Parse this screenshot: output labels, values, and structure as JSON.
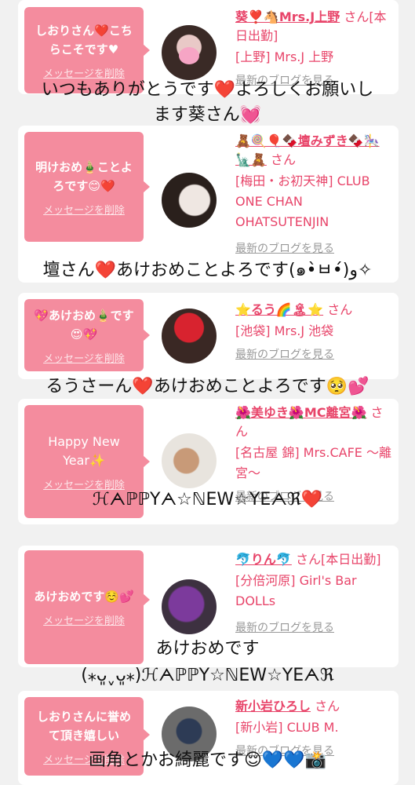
{
  "cards": [
    {
      "bubble": "しおりさん❤️こちらこそです♥",
      "delete": "メッセージを削除",
      "name": "葵❣️🐴Mrs.J上野",
      "san": "さん[本日出勤]",
      "shop": "[上野] Mrs.J 上野",
      "blog": "最新のブログを見る"
    },
    {
      "bubble": "明けおめ🎍ことよろです😊❤️",
      "delete": "メッセージを削除",
      "name": "🧸🍭🎈🍫壇みずき🍫🎠🗽🧸",
      "san": "さん",
      "shop": "[梅田・お初天神] CLUB ONE CHAN OHATSUTENJIN",
      "blog": "最新のブログを見る"
    },
    {
      "bubble": "💖あけおめ🎍です😍💖",
      "delete": "メッセージを削除",
      "name": "⭐るう🌈🏝⭐",
      "san": "さん",
      "shop": "[池袋] Mrs.J 池袋",
      "blog": "最新のブログを見る"
    },
    {
      "bubble": "Happy New Year✨",
      "delete": "メッセージを削除",
      "name": "🌺美ゆき🌺MC離宮🌺",
      "san": "さん",
      "shop": "[名古屋 錦] Mrs.CAFE 〜離宮〜",
      "blog": "最新のブログを見る"
    },
    {
      "bubble": "あけおめです☺️💕",
      "delete": "メッセージを削除",
      "name": "🐬りん🐬",
      "san": "さん[本日出勤]",
      "shop": "[分倍河原] Girl's Bar DOLLs",
      "blog": "最新のブログを見る"
    },
    {
      "bubble": "しおりさんに誉めて頂き嬉しい",
      "delete": "メッセージを削除",
      "name": "新小岩ひろし",
      "san": "さん",
      "shop": "[新小岩] CLUB M.",
      "blog": "最新のブログを見る"
    }
  ],
  "overlays": {
    "o1a": "いつもありがとうです❤️よろしくお願いし",
    "o1b": "ます葵さん💓",
    "o2": "壇さん❤️あけおめことよろです(๑•̀ㅂ•́)و✧",
    "o3": "るうさーん❤️あけおめことよろです🥺💕",
    "o4": "ℋᗅℙℙYᗅ☆ℕEW☆YEᗅℜ❤️",
    "o5a": "あけおめです",
    "o5b": "(⁎ᴗ͈ˬᴗ͈⁎)ℋᗅℙℙY☆ℕEW☆YEᗅℜ",
    "o6": "画角とかお綺麗です😌💙💙📸"
  },
  "colors": {
    "accent": "#e8456a",
    "bubble": "#f48c9e"
  }
}
